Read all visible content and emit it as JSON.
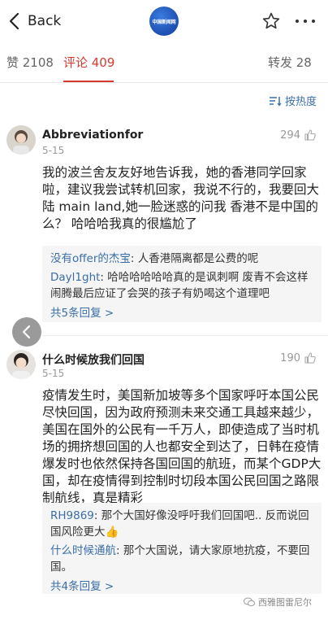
{
  "header": {
    "back_label": "Back",
    "logo_text": "中国新闻网"
  },
  "tabs": [
    {
      "label": "赞 2108"
    },
    {
      "label": "评论 409"
    },
    {
      "label": "转发 28"
    }
  ],
  "sort": {
    "label": "按热度"
  },
  "comments": [
    {
      "name": "Abbreviationfor",
      "date": "5-15",
      "likes": "294",
      "body": "我的波兰舍友友好地告诉我，她的香港同学回家啦，建议我尝试转机回家，我说不行的，我要回大陆 main land,她一脸迷惑的问我 香港不是中国的么？ 哈哈哈我真的很尴尬了",
      "replies": [
        {
          "name": "没有offer的杰宝",
          "text": ": 人香港隔离都是公费的呢"
        },
        {
          "name": "Dayl1ght",
          "text": ": 哈哈哈哈哈哈真的是讽刺啊 废青不会这样闹腾最后应证了会哭的孩子有奶喝这个道理吧"
        }
      ],
      "more_replies": "共5条回复 >"
    },
    {
      "name": "什么时候放我们回国",
      "date": "5-15",
      "likes": "190",
      "body": "疫情发生时，美国新加坡等多个国家呼吁本国公民尽快回国，因为政府预测未来交通工具越来越少，美国在国外的公民有一千万人，即使造成了当时机场的拥挤想回国的人也都安全到达了，日韩在疫情爆发时也依然保持各国回国的航班，而某个GDP大国，却在疫情得到控制时切段本国公民回国之路限制航线，真是精彩",
      "replies": [
        {
          "name": "RH9869",
          "text": ": 那个大国好像没呼吁我们回国吧.. 反而说回国风险更大👍"
        },
        {
          "name": "什么时候通航",
          "text": ": 那个大国说，请大家原地抗疫，不要回国。"
        }
      ],
      "more_replies": "共4条回复 >"
    }
  ],
  "watermark": {
    "text": "西雅图雷尼尔"
  }
}
